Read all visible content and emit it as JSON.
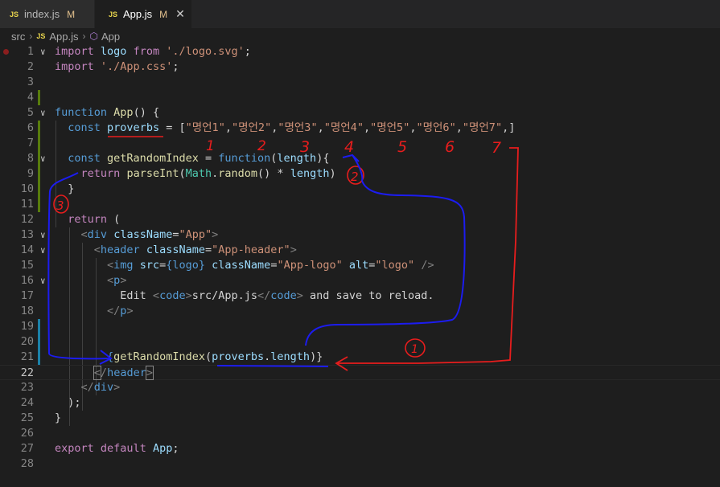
{
  "tabs": [
    {
      "icon": "JS",
      "label": "index.js",
      "status": "M",
      "active": false
    },
    {
      "icon": "JS",
      "label": "App.js",
      "status": "M",
      "active": true,
      "close": "✕"
    }
  ],
  "breadcrumb": {
    "folder": "src",
    "file": "App.js",
    "symbol": "App",
    "file_icon": "JS"
  },
  "gutter": [
    "1",
    "2",
    "3",
    "4",
    "5",
    "6",
    "7",
    "8",
    "9",
    "10",
    "11",
    "12",
    "13",
    "14",
    "15",
    "16",
    "17",
    "18",
    "19",
    "20",
    "21",
    "22",
    "23",
    "24",
    "25",
    "26",
    "27",
    "28"
  ],
  "code": {
    "l1": {
      "kw1": "import",
      "v": "logo",
      "kw2": "from",
      "s": "'./logo.svg'",
      "end": ";"
    },
    "l2": {
      "kw": "import",
      "s": "'./App.css'",
      "end": ";"
    },
    "l5": {
      "kw": "function",
      "name": "App",
      "rest": "() {"
    },
    "l6": {
      "kw": "const",
      "v": "proverbs",
      "op": " = [",
      "items": [
        "\"명언1\"",
        "\"명언2\"",
        "\"명언3\"",
        "\"명언4\"",
        "\"명언5\"",
        "\"명언6\"",
        "\"명언7\""
      ],
      "end": ",]"
    },
    "l8": {
      "kw": "const",
      "name": "getRandomIndex",
      "op": " = ",
      "kw2": "function",
      "p1": "(",
      "arg": "length",
      "p2": "){"
    },
    "l9": {
      "kw": "return",
      "f": "parseInt",
      "obj": "Math",
      "dot": ".",
      "m": "random",
      "rest": "() * ",
      "arg": "length",
      "end": ")"
    },
    "l10": {
      "t": "}"
    },
    "l12": {
      "kw": "return",
      "rest": " ("
    },
    "l13": {
      "tag": "div",
      "attr": "className",
      "eq": "=",
      "val": "\"App\""
    },
    "l14": {
      "tag": "header",
      "attr": "className",
      "eq": "=",
      "val": "\"App-header\""
    },
    "l15": {
      "tag": "img",
      "a1": "src",
      "v1": "{logo}",
      "a2": "className",
      "v2": "\"App-logo\"",
      "a3": "alt",
      "v3": "\"logo\"",
      "end": " />"
    },
    "l16": {
      "tag": "p"
    },
    "l17": {
      "text1": "Edit ",
      "tag": "code",
      "text2": "src/App.js",
      "text3": " and save to reload."
    },
    "l18": {
      "tag": "p"
    },
    "l21": {
      "b1": "{",
      "f": "getRandomIndex",
      "p": "(",
      "v": "proverbs",
      "dot": ".",
      "prop": "length",
      "b2": ")}"
    },
    "l22": {
      "tag": "header"
    },
    "l23": {
      "tag": "div"
    },
    "l24": {
      "t": ");"
    },
    "l25": {
      "t": "}"
    },
    "l27": {
      "kw1": "export",
      "kw2": "default",
      "name": "App",
      "end": ";"
    }
  },
  "annotations": {
    "red": [
      "1",
      "2",
      "3",
      "4",
      "5",
      "6",
      "7"
    ],
    "circled_1": "1",
    "circled_2": "2",
    "circled_3": "3"
  },
  "colors": {
    "accent_red": "#e81d1d",
    "accent_blue": "#1c1cf0",
    "add_bar": "#587c0c",
    "mod_bar": "#1b81a8"
  }
}
